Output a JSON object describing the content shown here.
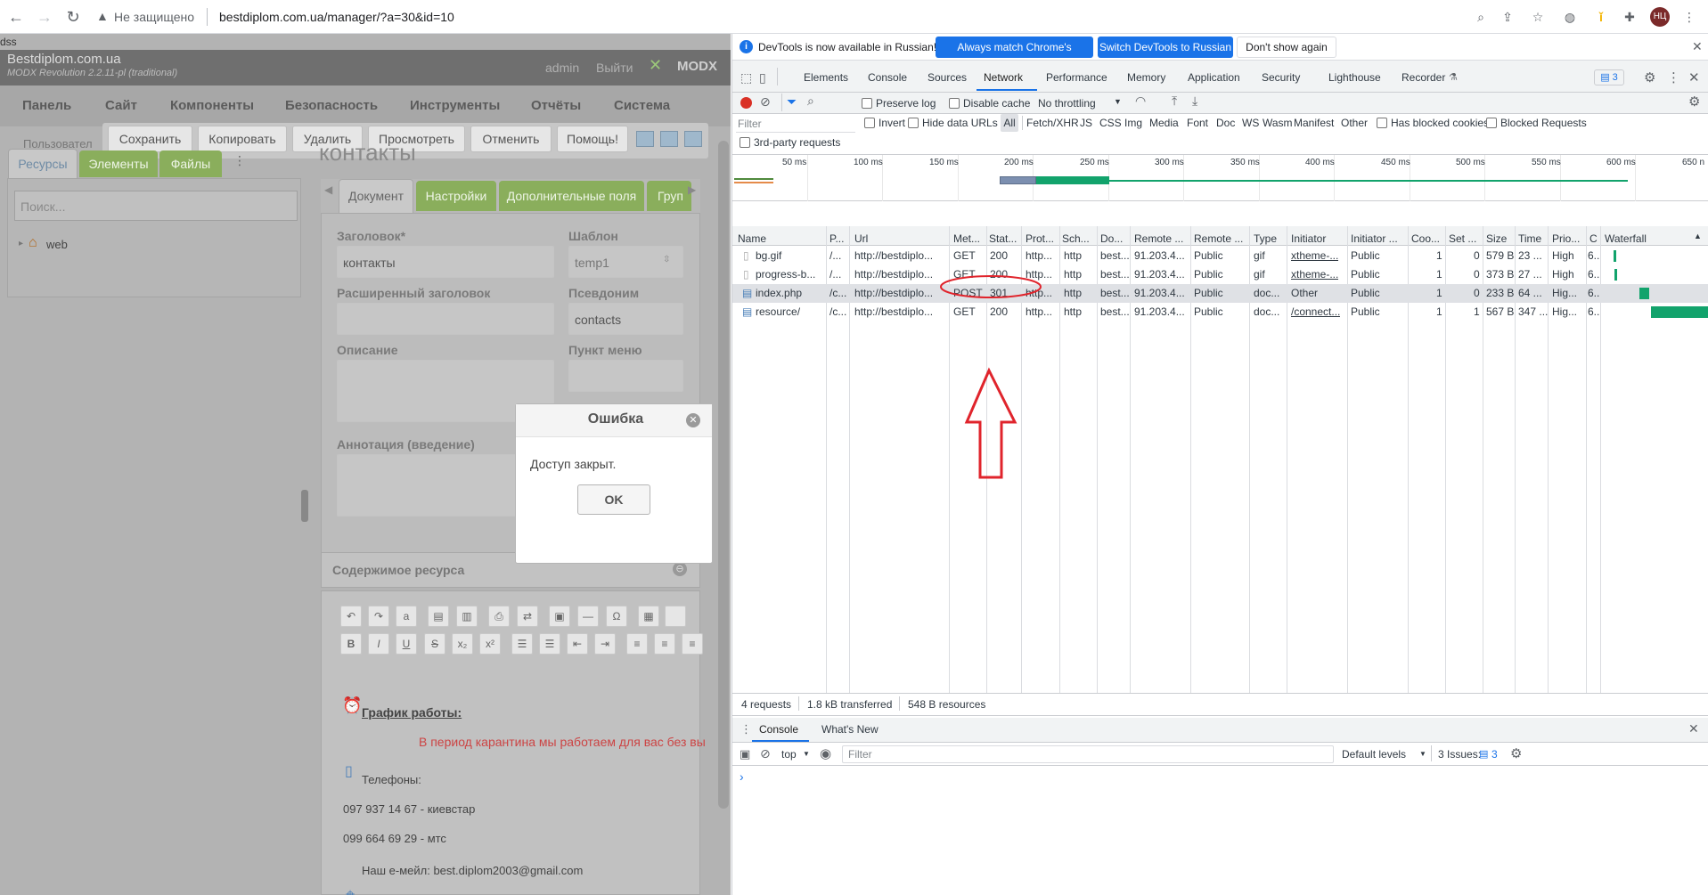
{
  "browser": {
    "security_label": "Не защищено",
    "url": "bestdiplom.com.ua/manager/?a=30&id=10",
    "profile_initials": "НЦ"
  },
  "page": {
    "corner_text": "dss",
    "site_name": "Bestdiplom.com.ua",
    "version": "MODX Revolution 2.2.11-pl (traditional)",
    "user": "admin",
    "logout": "Выйти",
    "logo": "MODX",
    "menu": [
      "Панель",
      "Сайт",
      "Компоненты",
      "Безопасность",
      "Инструменты",
      "Отчёты",
      "Система"
    ],
    "behind_text": "Пользовател",
    "actions": [
      "Сохранить",
      "Копировать",
      "Удалить",
      "Просмотреть",
      "Отменить",
      "Помощь!"
    ],
    "tree_tabs": [
      "Ресурсы",
      "Элементы",
      "Файлы"
    ],
    "search_placeholder": "Поиск...",
    "tree_node": "web",
    "resource_title": "контакты",
    "form_tabs": [
      "Документ",
      "Настройки",
      "Дополнительные поля",
      "Груп"
    ],
    "labels": {
      "title": "Заголовок*",
      "template": "Шаблон",
      "longtitle": "Расширенный заголовок",
      "alias": "Псевдоним",
      "description": "Описание",
      "menu": "Пункт меню",
      "intro": "Аннотация (введение)"
    },
    "values": {
      "title": "контакты",
      "template": "temp1",
      "alias": "contacts"
    },
    "content_header": "Содержимое ресурса",
    "content": {
      "schedule": "График работы:",
      "quarantine": "В период карантина мы работаем для вас без вы",
      "phones_label": "Телефоны:",
      "phone1": "097 937 14 67 - киевстар",
      "phone2": "099 664 69 29 - мтс",
      "email": "Наш е-мейл: best.diplom2003@gmail.com"
    },
    "dialog": {
      "title": "Ошибка",
      "message": "Доступ закрыт.",
      "ok": "OK"
    }
  },
  "devtools": {
    "infobar": {
      "text": "DevTools is now available in Russian!",
      "btn1": "Always match Chrome's language",
      "btn2": "Switch DevTools to Russian",
      "btn3": "Don't show again"
    },
    "tabs": [
      "Elements",
      "Console",
      "Sources",
      "Network",
      "Performance",
      "Memory",
      "Application",
      "Security",
      "Lighthouse",
      "Recorder"
    ],
    "active_tab": "Network",
    "issues_count": "3",
    "toolbar": {
      "preserve_log": "Preserve log",
      "disable_cache": "Disable cache",
      "throttling": "No throttling"
    },
    "filter": {
      "placeholder": "Filter",
      "invert": "Invert",
      "hide_data_urls": "Hide data URLs",
      "types": [
        "All",
        "Fetch/XHR",
        "JS",
        "CSS",
        "Img",
        "Media",
        "Font",
        "Doc",
        "WS",
        "Wasm",
        "Manifest",
        "Other"
      ],
      "blocked_cookies": "Has blocked cookies",
      "blocked_requests": "Blocked Requests",
      "third_party": "3rd-party requests"
    },
    "timeline_ticks": [
      "50 ms",
      "100 ms",
      "150 ms",
      "200 ms",
      "250 ms",
      "300 ms",
      "350 ms",
      "400 ms",
      "450 ms",
      "500 ms",
      "550 ms",
      "600 ms",
      "650 n"
    ],
    "columns": [
      "Name",
      "P...",
      "Url",
      "Met...",
      "Stat...",
      "Prot...",
      "Sch...",
      "Do...",
      "Remote ...",
      "Remote ...",
      "Type",
      "Initiator",
      "Initiator ...",
      "Coo...",
      "Set ...",
      "Size",
      "Time",
      "Prio...",
      "C",
      "Waterfall"
    ],
    "rows": [
      {
        "name": "bg.gif",
        "path": "/...",
        "url": "http://bestdiplo...",
        "method": "GET",
        "status": "200",
        "proto": "http...",
        "scheme": "http",
        "domain": "best...",
        "ip": "91.203.4...",
        "space": "Public",
        "type": "gif",
        "initiator": "xtheme-...",
        "init_space": "Public",
        "cookies": "1",
        "set": "0",
        "size": "579 B",
        "time": "23 ...",
        "prio": "High",
        "c": "6..."
      },
      {
        "name": "progress-b...",
        "path": "/...",
        "url": "http://bestdiplo...",
        "method": "GET",
        "status": "200",
        "proto": "http...",
        "scheme": "http",
        "domain": "best...",
        "ip": "91.203.4...",
        "space": "Public",
        "type": "gif",
        "initiator": "xtheme-...",
        "init_space": "Public",
        "cookies": "1",
        "set": "0",
        "size": "373 B",
        "time": "27 ...",
        "prio": "High",
        "c": "6..."
      },
      {
        "name": "index.php",
        "path": "/c...",
        "url": "http://bestdiplo...",
        "method": "POST",
        "status": "301",
        "proto": "http...",
        "scheme": "http",
        "domain": "best...",
        "ip": "91.203.4...",
        "space": "Public",
        "type": "doc...",
        "initiator": "Other",
        "init_space": "Public",
        "cookies": "1",
        "set": "0",
        "size": "233 B",
        "time": "64 ...",
        "prio": "Hig...",
        "c": "6..."
      },
      {
        "name": "resource/",
        "path": "/c...",
        "url": "http://bestdiplo...",
        "method": "GET",
        "status": "200",
        "proto": "http...",
        "scheme": "http",
        "domain": "best...",
        "ip": "91.203.4...",
        "space": "Public",
        "type": "doc...",
        "initiator": "/connect...",
        "init_space": "Public",
        "cookies": "1",
        "set": "1",
        "size": "567 B",
        "time": "347 ...",
        "prio": "Hig...",
        "c": "6..."
      }
    ],
    "status": {
      "requests": "4 requests",
      "transferred": "1.8 kB transferred",
      "resources": "548 B resources"
    },
    "drawer": {
      "tabs": [
        "Console",
        "What's New"
      ],
      "context": "top",
      "filter_placeholder": "Filter",
      "levels": "Default levels",
      "issues": "3 Issues:",
      "issues_count": "3",
      "prompt": "›"
    }
  },
  "colors": {
    "modx_green": "#8aae5c",
    "annotation_red": "#e0242c",
    "devtools_accent": "#1a73e8"
  }
}
